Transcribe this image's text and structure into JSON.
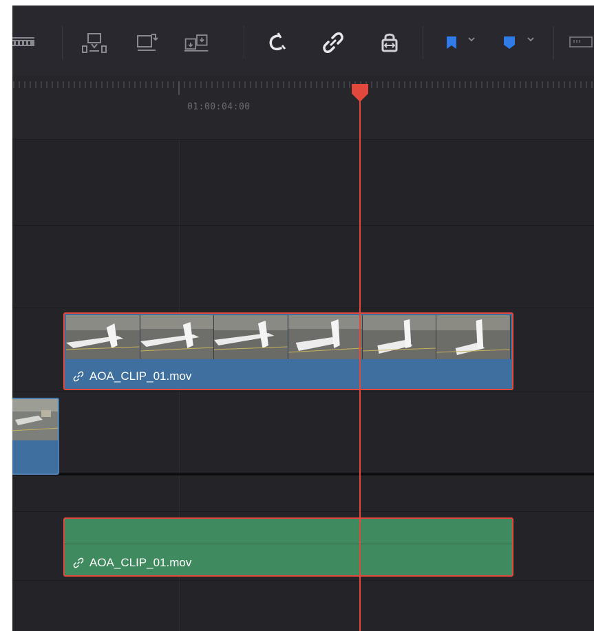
{
  "window": {
    "background": "#232328"
  },
  "toolbar": {
    "icons": [
      "blade-edit-icon",
      "insert-clip-icon",
      "overwrite-clip-icon",
      "replace-clip-icon",
      "snapping-icon",
      "linked-selection-icon",
      "position-lock-icon",
      "flag-icon",
      "marker-icon",
      "view-options-icon"
    ],
    "flag_color": "#2f7be8",
    "marker_color": "#2f7be8"
  },
  "ruler": {
    "timecode": "01:00:04:00"
  },
  "playhead": {
    "color": "#e2483c"
  },
  "video_clip": {
    "name": "AOA_CLIP_01.mov",
    "selected": true,
    "color": "#3e6f9e"
  },
  "audio_clip": {
    "name": "AOA_CLIP_01.mov",
    "selected": true,
    "color": "#3f8a5f"
  }
}
